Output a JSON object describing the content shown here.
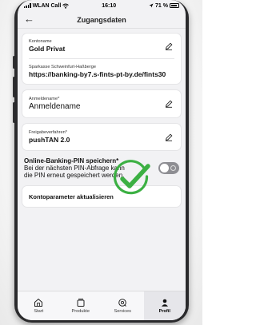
{
  "status": {
    "carrier": "WLAN Call",
    "time": "16:10",
    "battery": "71 %"
  },
  "nav": {
    "title": "Zugangsdaten"
  },
  "account": {
    "label": "Kontoname",
    "value": "Gold Privat"
  },
  "server": {
    "label": "Sparkasse Schweinfurt-Haßberge",
    "value": "https://banking-by7.s-fints-pt-by.de/fints30"
  },
  "login": {
    "label": "Anmeldename*",
    "value": "Anmeldename"
  },
  "approval": {
    "label": "Freigabeverfahren*",
    "value": "pushTAN 2.0"
  },
  "pin": {
    "title": "Online-Banking-PIN speichern*",
    "line1": "Bei der nächsten PIN-Abfrage kann",
    "line2": "die PIN erneut gespeichert werden.",
    "enabled": false
  },
  "refresh": {
    "label": "Kontoparameter aktualisieren"
  },
  "tabs": [
    {
      "label": "Start",
      "icon": "home-icon"
    },
    {
      "label": "Produkte",
      "icon": "products-icon"
    },
    {
      "label": "Services",
      "icon": "services-icon"
    },
    {
      "label": "Profil",
      "icon": "profile-icon"
    }
  ],
  "colors": {
    "checkmark": "#3cb043",
    "active_tab": "#e6e6ea"
  }
}
